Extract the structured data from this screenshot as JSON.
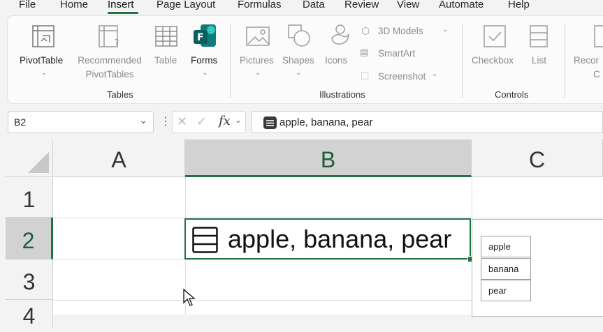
{
  "menu": {
    "tabs": [
      "File",
      "Home",
      "Insert",
      "Page Layout",
      "Formulas",
      "Data",
      "Review",
      "View",
      "Automate",
      "Help"
    ],
    "active_tab": "Insert"
  },
  "ribbon": {
    "pivot_table": "PivotTable",
    "recommended_line1": "Recommended",
    "recommended_line2": "PivotTables",
    "table": "Table",
    "forms": "Forms",
    "pictures": "Pictures",
    "shapes": "Shapes",
    "icons": "Icons",
    "models_3d": "3D Models",
    "smartart": "SmartArt",
    "screenshot": "Screenshot",
    "checkbox": "Checkbox",
    "list": "List",
    "reco_partial_1": "Recor",
    "reco_partial_2": "C",
    "group_tables": "Tables",
    "group_illustrations": "Illustrations",
    "group_controls": "Controls"
  },
  "formula_bar": {
    "name_box": "B2",
    "fx": "fx",
    "formula": "apple, banana, pear"
  },
  "grid": {
    "columns": [
      "A",
      "B",
      "C"
    ],
    "rows": [
      "1",
      "2",
      "3",
      "4"
    ],
    "cell_b2": "apple, banana, pear",
    "list_items": [
      "apple",
      "banana",
      "pear"
    ]
  },
  "colors": {
    "accent": "#217346",
    "selected_header": "#d2d2d2"
  }
}
